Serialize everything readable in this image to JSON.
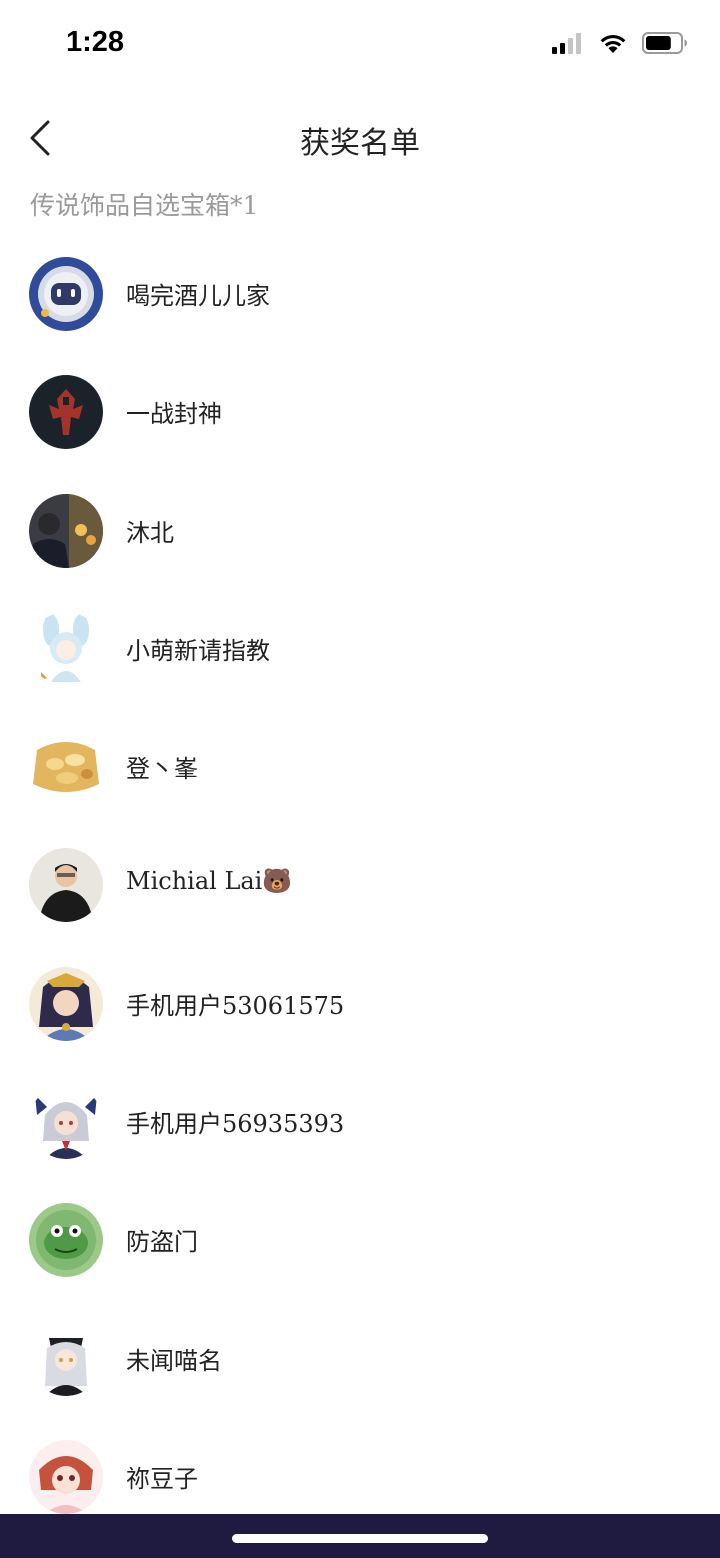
{
  "status_bar": {
    "time": "1:28",
    "signal_icon": "cellular-signal-icon",
    "wifi_icon": "wifi-icon",
    "battery_icon": "battery-icon",
    "battery_level": 0.75,
    "signal_bars_filled": 2
  },
  "header": {
    "back_icon": "chevron-left-icon",
    "title": "获奖名单"
  },
  "prize_section": {
    "title": "传说饰品自选宝箱*1"
  },
  "winners": [
    {
      "name": "喝完酒儿儿家",
      "avatar": "robot-avatar"
    },
    {
      "name": "一战封神",
      "avatar": "horde-emblem-avatar"
    },
    {
      "name": "沐北",
      "avatar": "photo-avatar"
    },
    {
      "name": "小萌新请指教",
      "avatar": "bunny-hood-avatar"
    },
    {
      "name": "登丶峯",
      "avatar": "food-avatar"
    },
    {
      "name": "Michial Lai🐻",
      "avatar": "man-portrait-avatar"
    },
    {
      "name": "手机用户53061575",
      "avatar": "anime-girl-avatar"
    },
    {
      "name": "手机用户56935393",
      "avatar": "anime-silver-hair-avatar"
    },
    {
      "name": "防盗门",
      "avatar": "green-frog-avatar"
    },
    {
      "name": "未闻喵名",
      "avatar": "anime-soldier-avatar"
    },
    {
      "name": "祢豆子",
      "avatar": "anime-red-hair-avatar"
    }
  ],
  "colors": {
    "background": "#ffffff",
    "text_primary": "#222222",
    "text_secondary": "#9a9a9a",
    "home_bar": "#1e1a40"
  }
}
